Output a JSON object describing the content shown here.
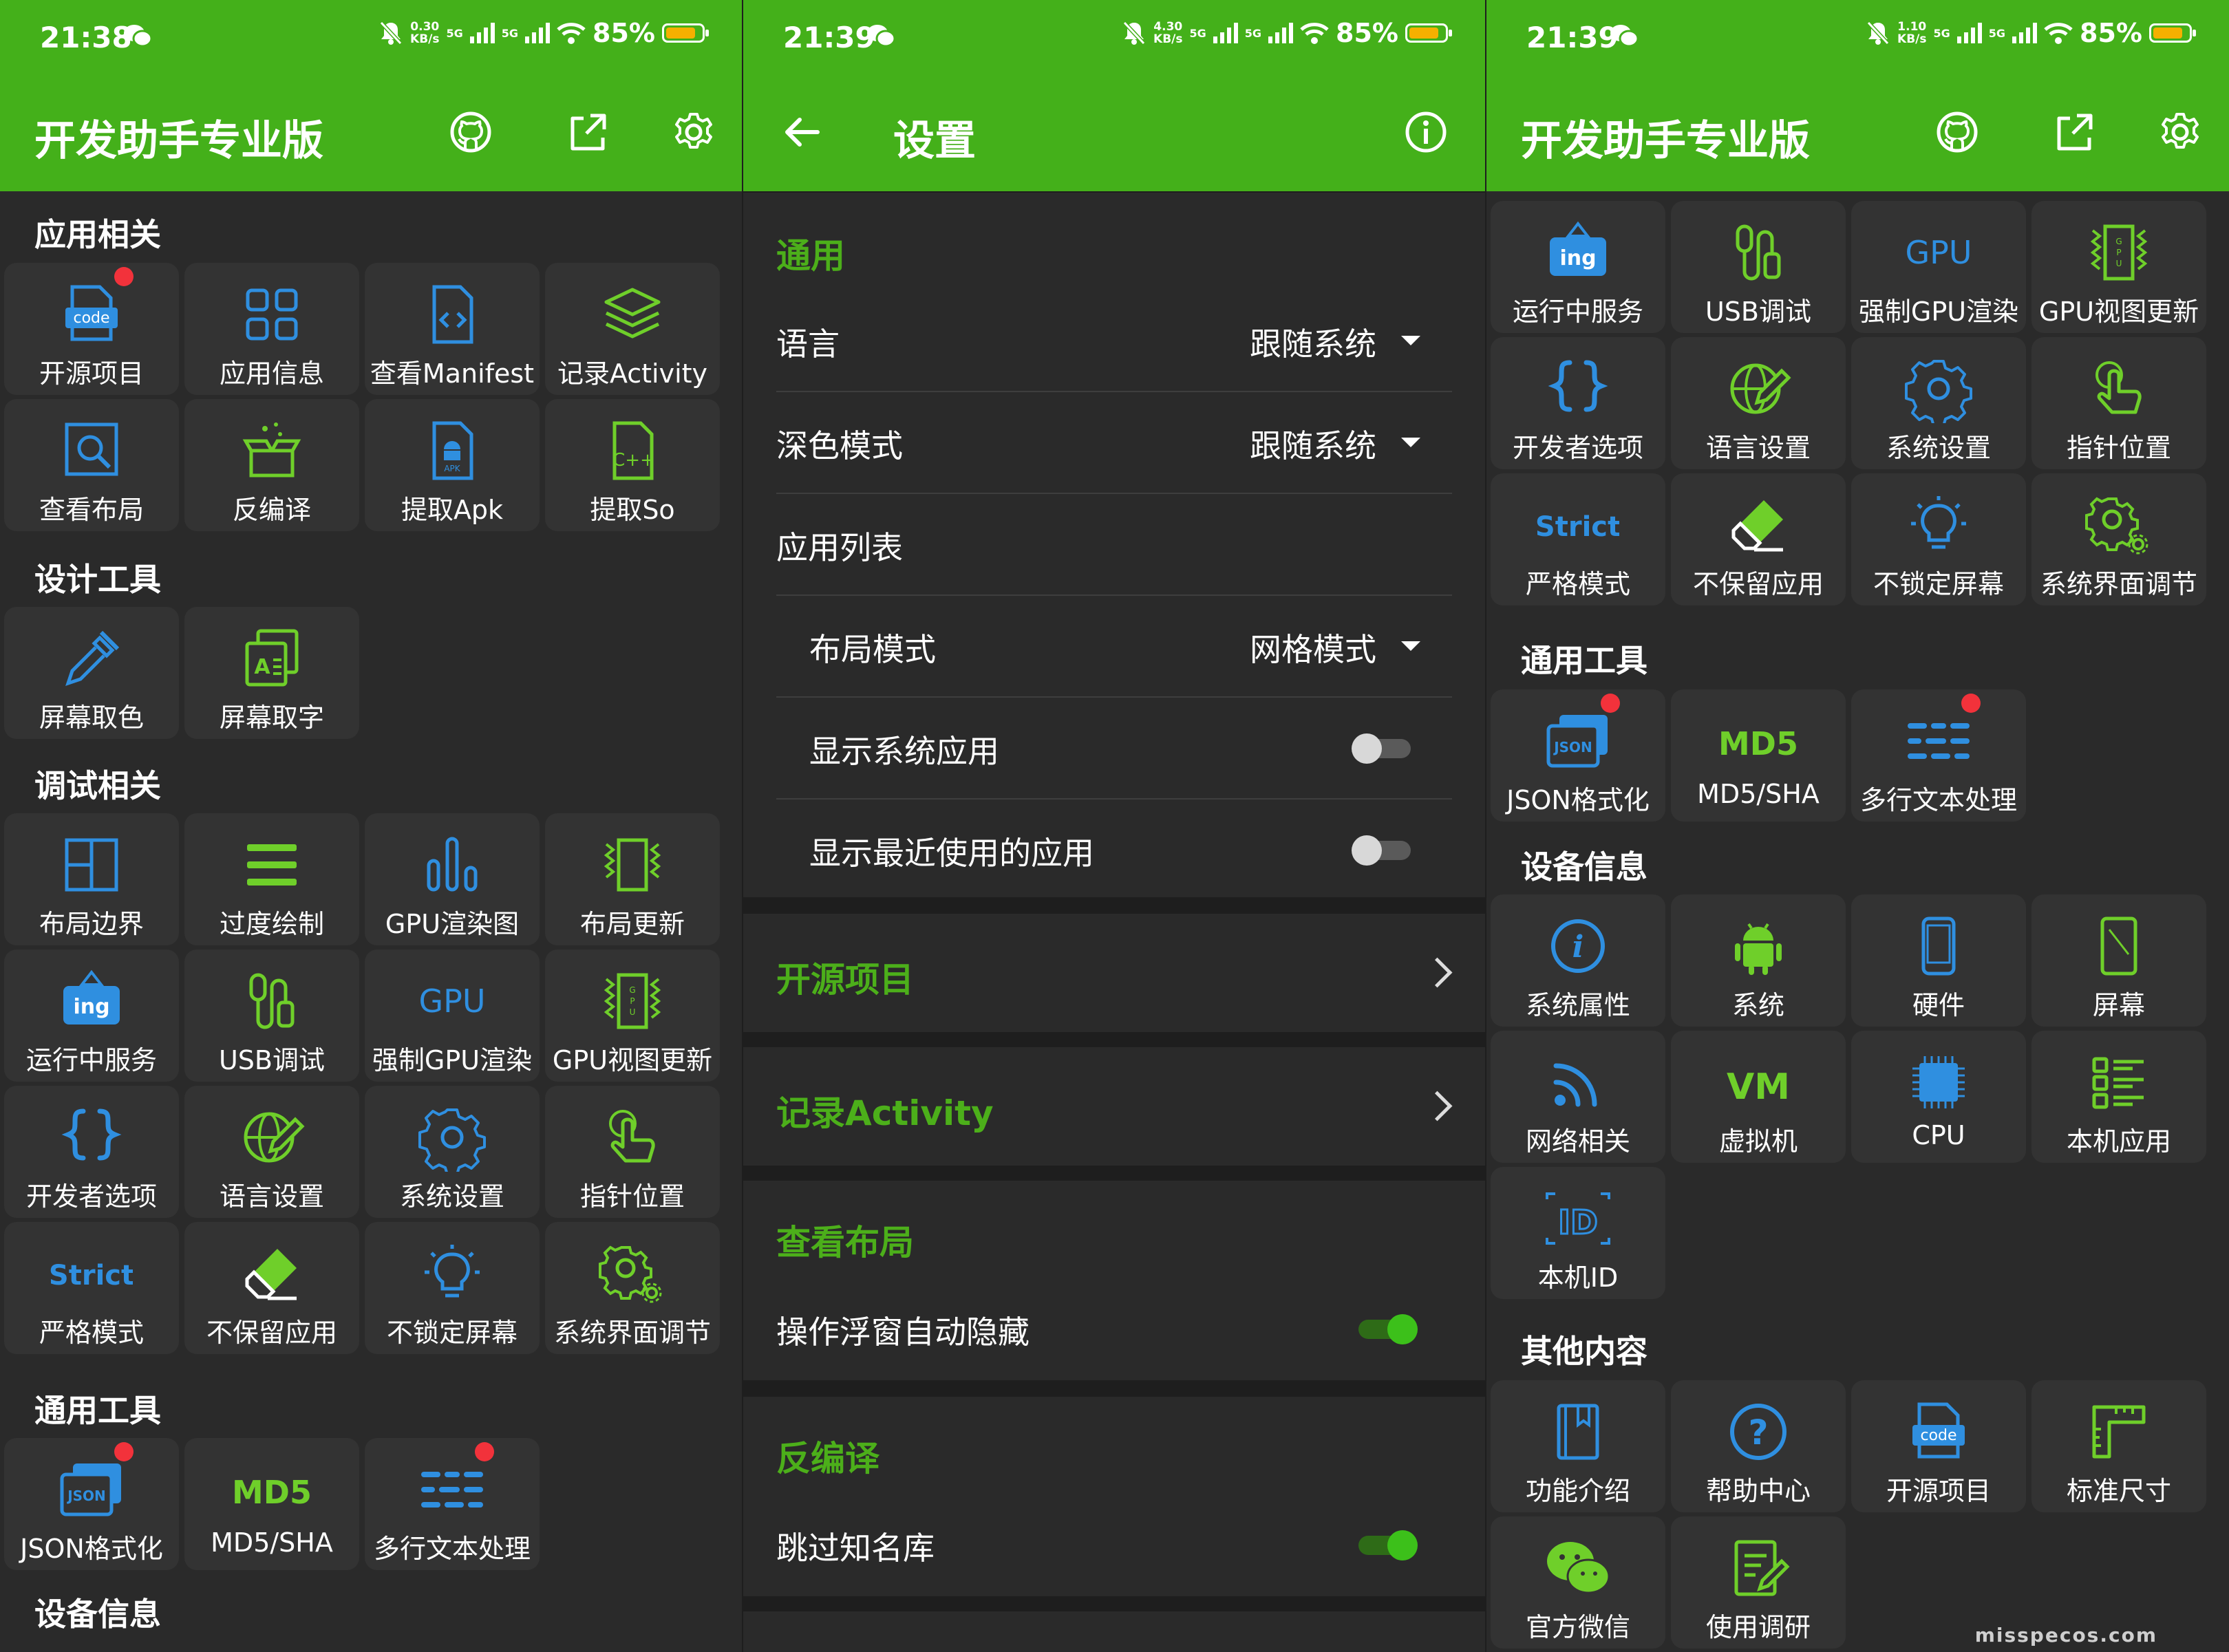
{
  "status": {
    "p1": {
      "time": "21:38",
      "speed": "0.30",
      "speed_unit": "KB/s",
      "net1": "5G",
      "net2": "5G",
      "battery": "85%"
    },
    "p2": {
      "time": "21:39",
      "speed": "4.30",
      "speed_unit": "KB/s",
      "net1": "5G",
      "net2": "5G",
      "battery": "85%"
    },
    "p3": {
      "time": "21:39",
      "speed": "1.10",
      "speed_unit": "KB/s",
      "net1": "5G",
      "net2": "5G",
      "battery": "85%"
    },
    "battery_level": 0.85
  },
  "colors": {
    "appbar": "#44b01a",
    "accent": "#4caf1a",
    "tile": "#333333",
    "background": "#2a2a2a",
    "badge": "#f2323b",
    "icon_blue": "#2f8fe0",
    "icon_green": "#6fcf2a"
  },
  "p1": {
    "title": "开发助手专业版",
    "sections": [
      "应用相关",
      "设计工具",
      "调试相关",
      "通用工具",
      "设备信息"
    ],
    "tiles": [
      {
        "label": "开源项目",
        "icon": "code-file-icon"
      },
      {
        "label": "应用信息",
        "icon": "apps-grid-icon"
      },
      {
        "label": "查看Manifest",
        "icon": "manifest-file-icon"
      },
      {
        "label": "记录Activity",
        "icon": "layers-icon"
      },
      {
        "label": "查看布局",
        "icon": "inspect-layout-icon"
      },
      {
        "label": "反编译",
        "icon": "open-box-icon"
      },
      {
        "label": "提取Apk",
        "icon": "apk-file-icon"
      },
      {
        "label": "提取So",
        "icon": "cpp-file-icon"
      },
      {
        "label": "屏幕取色",
        "icon": "eyedropper-icon"
      },
      {
        "label": "屏幕取字",
        "icon": "text-capture-icon"
      },
      {
        "label": "布局边界",
        "icon": "layout-bounds-icon"
      },
      {
        "label": "过度绘制",
        "icon": "overdraw-icon"
      },
      {
        "label": "GPU渲染图",
        "icon": "bar-chart-icon"
      },
      {
        "label": "布局更新",
        "icon": "layout-update-icon"
      },
      {
        "label": "运行中服务",
        "icon": "running-services-icon"
      },
      {
        "label": "USB调试",
        "icon": "usb-icon"
      },
      {
        "label": "强制GPU渲染",
        "icon": "gpu-text-icon"
      },
      {
        "label": "GPU视图更新",
        "icon": "gpu-view-icon"
      },
      {
        "label": "开发者选项",
        "icon": "braces-icon"
      },
      {
        "label": "语言设置",
        "icon": "globe-pen-icon"
      },
      {
        "label": "系统设置",
        "icon": "gear-icon"
      },
      {
        "label": "指针位置",
        "icon": "pointer-hand-icon"
      },
      {
        "label": "严格模式",
        "icon": "strict-text-icon"
      },
      {
        "label": "不保留应用",
        "icon": "eraser-icon"
      },
      {
        "label": "不锁定屏幕",
        "icon": "bulb-icon"
      },
      {
        "label": "系统界面调节",
        "icon": "gears-icon"
      },
      {
        "label": "JSON格式化",
        "icon": "json-icon"
      },
      {
        "label": "MD5/SHA",
        "icon": "md5-icon"
      },
      {
        "label": "多行文本处理",
        "icon": "multiline-icon"
      }
    ]
  },
  "p2": {
    "title": "设置",
    "sections": [
      "通用",
      "开源项目",
      "记录Activity",
      "查看布局",
      "反编译"
    ],
    "rows": [
      {
        "label": "语言",
        "value": "跟随系统"
      },
      {
        "label": "深色模式",
        "value": "跟随系统"
      },
      {
        "label": "应用列表"
      },
      {
        "label": "布局模式",
        "value": "网格模式"
      },
      {
        "label": "显示系统应用",
        "on": false
      },
      {
        "label": "显示最近使用的应用",
        "on": false
      },
      {
        "label": "操作浮窗自动隐藏",
        "on": true
      },
      {
        "label": "跳过知名库",
        "on": true
      }
    ]
  },
  "p3": {
    "title": "开发助手专业版",
    "sections": [
      "通用工具",
      "设备信息",
      "其他内容"
    ],
    "tiles": [
      {
        "label": "运行中服务",
        "icon": "running-services-icon"
      },
      {
        "label": "USB调试",
        "icon": "usb-icon"
      },
      {
        "label": "强制GPU渲染",
        "icon": "gpu-text-icon"
      },
      {
        "label": "GPU视图更新",
        "icon": "gpu-view-icon"
      },
      {
        "label": "开发者选项",
        "icon": "braces-icon"
      },
      {
        "label": "语言设置",
        "icon": "globe-pen-icon"
      },
      {
        "label": "系统设置",
        "icon": "gear-icon"
      },
      {
        "label": "指针位置",
        "icon": "pointer-hand-icon"
      },
      {
        "label": "严格模式",
        "icon": "strict-text-icon"
      },
      {
        "label": "不保留应用",
        "icon": "eraser-icon"
      },
      {
        "label": "不锁定屏幕",
        "icon": "bulb-icon"
      },
      {
        "label": "系统界面调节",
        "icon": "gears-icon"
      },
      {
        "label": "JSON格式化",
        "icon": "json-icon"
      },
      {
        "label": "MD5/SHA",
        "icon": "md5-icon"
      },
      {
        "label": "多行文本处理",
        "icon": "multiline-icon"
      },
      {
        "label": "系统属性",
        "icon": "info-icon"
      },
      {
        "label": "系统",
        "icon": "android-icon"
      },
      {
        "label": "硬件",
        "icon": "phone-icon"
      },
      {
        "label": "屏幕",
        "icon": "screen-icon"
      },
      {
        "label": "网络相关",
        "icon": "network-icon"
      },
      {
        "label": "虚拟机",
        "icon": "vm-icon"
      },
      {
        "label": "CPU",
        "icon": "cpu-chip-icon"
      },
      {
        "label": "本机应用",
        "icon": "app-list-icon"
      },
      {
        "label": "本机ID",
        "icon": "id-icon"
      },
      {
        "label": "功能介绍",
        "icon": "book-icon"
      },
      {
        "label": "帮助中心",
        "icon": "help-icon"
      },
      {
        "label": "开源项目",
        "icon": "code-file-icon"
      },
      {
        "label": "标准尺寸",
        "icon": "ruler-icon"
      },
      {
        "label": "官方微信",
        "icon": "wechat-icon"
      },
      {
        "label": "使用调研",
        "icon": "survey-icon"
      }
    ]
  },
  "icon_text": {
    "code": "code",
    "apk": "APK",
    "cpp": "C++",
    "ing": "ing",
    "gpu": "GPU",
    "gpu_v": "GPU",
    "strict": "Strict",
    "json": "JSON",
    "md5": "MD5",
    "vm": "VM",
    "id": "ID",
    "info": "i",
    "help": "?"
  },
  "watermark": "misspecos.com"
}
